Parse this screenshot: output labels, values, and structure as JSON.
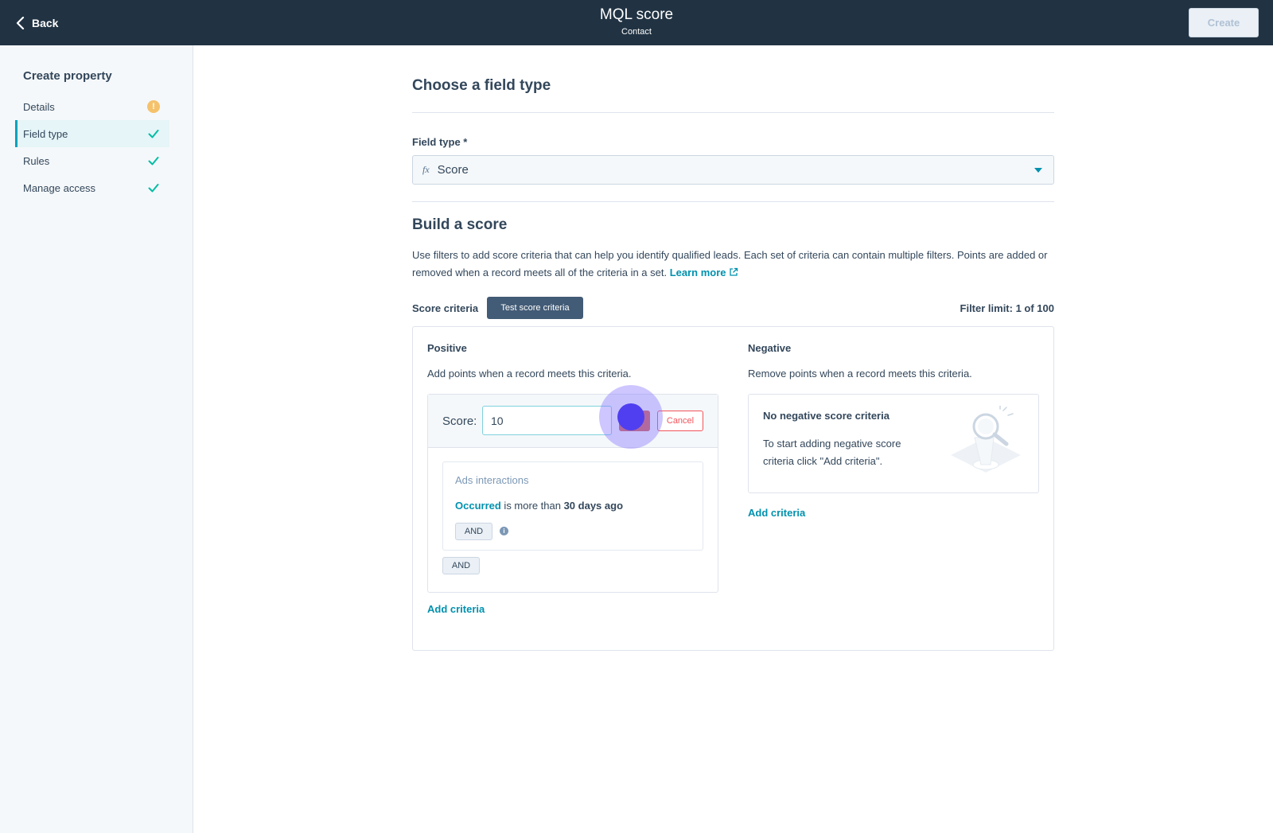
{
  "header": {
    "back_label": "Back",
    "title": "MQL score",
    "subtitle": "Contact",
    "create_label": "Create"
  },
  "sidebar": {
    "title": "Create property",
    "items": [
      {
        "label": "Details",
        "status": "warning-icon"
      },
      {
        "label": "Field type",
        "status": "check-icon",
        "active": true
      },
      {
        "label": "Rules",
        "status": "check-icon"
      },
      {
        "label": "Manage access",
        "status": "check-icon"
      }
    ]
  },
  "field_type": {
    "heading": "Choose a field type",
    "label": "Field type *",
    "icon_text": "fx",
    "value": "Score"
  },
  "build": {
    "heading": "Build a score",
    "description": "Use filters to add score criteria that can help you identify qualified leads. Each set of criteria can contain multiple filters. Points are added or removed when a record meets all of the criteria in a set.",
    "learn_more": "Learn more",
    "score_criteria_label": "Score criteria",
    "test_button": "Test score criteria",
    "filter_limit": "Filter limit: 1 of 100"
  },
  "positive": {
    "heading": "Positive",
    "description": "Add points when a record meets this criteria.",
    "score_label": "Score:",
    "score_value": "10",
    "cancel_label": "Cancel",
    "filter": {
      "title": "Ads interactions",
      "link": "Occurred",
      "middle": " is more than ",
      "bold": "30 days ago",
      "and_label": "AND",
      "info": "i"
    },
    "and_label": "AND",
    "add_criteria": "Add criteria"
  },
  "negative": {
    "heading": "Negative",
    "description": "Remove points when a record meets this criteria.",
    "empty_title": "No negative score criteria",
    "empty_text": "To start adding negative score criteria click \"Add criteria\".",
    "add_criteria": "Add criteria"
  },
  "colors": {
    "topbar": "#213343",
    "accent": "#00a4bd",
    "link": "#0091ae",
    "check": "#00bda5",
    "warning": "#f5c26b",
    "danger": "#f2545b"
  }
}
